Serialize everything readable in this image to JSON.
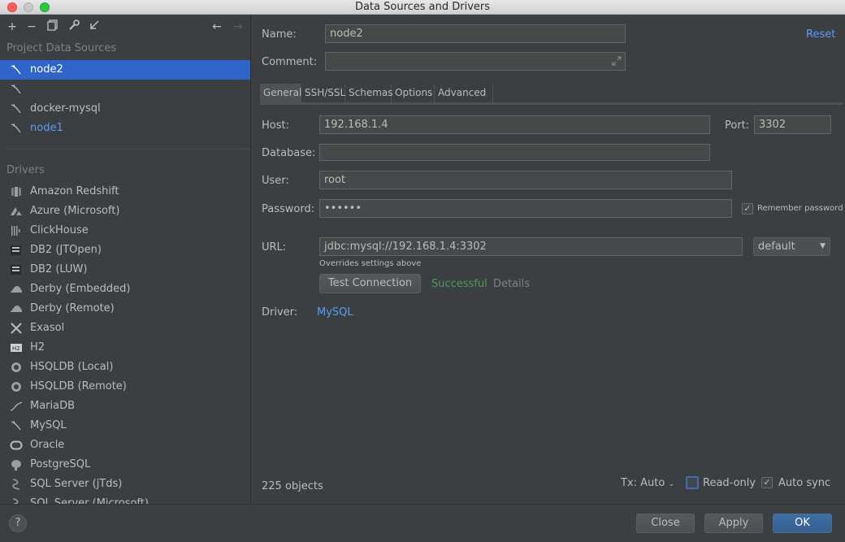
{
  "window": {
    "title": "Data Sources and Drivers"
  },
  "sidebar": {
    "project_heading": "Project Data Sources",
    "data_sources": [
      {
        "label": "node2",
        "state": "selected"
      },
      {
        "label": "",
        "state": "normal"
      },
      {
        "label": "docker-mysql",
        "state": "normal"
      },
      {
        "label": "node1",
        "state": "linked"
      }
    ],
    "drivers_heading": "Drivers",
    "drivers": [
      {
        "label": "Amazon Redshift",
        "icon": "redshift-icon"
      },
      {
        "label": "Azure (Microsoft)",
        "icon": "azure-icon"
      },
      {
        "label": "ClickHouse",
        "icon": "clickhouse-icon"
      },
      {
        "label": "DB2 (JTOpen)",
        "icon": "db2-icon"
      },
      {
        "label": "DB2 (LUW)",
        "icon": "db2-icon"
      },
      {
        "label": "Derby (Embedded)",
        "icon": "derby-icon"
      },
      {
        "label": "Derby (Remote)",
        "icon": "derby-icon"
      },
      {
        "label": "Exasol",
        "icon": "exasol-icon"
      },
      {
        "label": "H2",
        "icon": "h2-icon"
      },
      {
        "label": "HSQLDB (Local)",
        "icon": "hsqldb-icon"
      },
      {
        "label": "HSQLDB (Remote)",
        "icon": "hsqldb-icon"
      },
      {
        "label": "MariaDB",
        "icon": "mariadb-icon"
      },
      {
        "label": "MySQL",
        "icon": "mysql-icon"
      },
      {
        "label": "Oracle",
        "icon": "oracle-icon"
      },
      {
        "label": "PostgreSQL",
        "icon": "postgresql-icon"
      },
      {
        "label": "SQL Server (jTds)",
        "icon": "sqlserver-icon"
      },
      {
        "label": "SQL Server (Microsoft)",
        "icon": "sqlserver-icon"
      }
    ]
  },
  "form": {
    "name_label": "Name:",
    "name_value": "node2",
    "reset_label": "Reset",
    "comment_label": "Comment:",
    "comment_value": "",
    "tabs": [
      "General",
      "SSH/SSL",
      "Schemas",
      "Options",
      "Advanced"
    ],
    "host_label": "Host:",
    "host_value": "192.168.1.4",
    "port_label": "Port:",
    "port_value": "3302",
    "database_label": "Database:",
    "database_value": "",
    "user_label": "User:",
    "user_value": "root",
    "password_label": "Password:",
    "password_value": "••••••",
    "remember_label": "Remember password",
    "url_label": "URL:",
    "url_value": "jdbc:mysql://192.168.1.4:3302",
    "url_mode": "default",
    "overrides_note": "Overrides settings above",
    "test_connection_label": "Test Connection",
    "test_status": "Successful",
    "details_label": "Details",
    "driver_label": "Driver:",
    "driver_value": "MySQL"
  },
  "status": {
    "objects_count": "225 objects",
    "tx_label": "Tx: Auto",
    "readonly_label": "Read-only",
    "autosync_label": "Auto sync"
  },
  "footer": {
    "help_label": "?",
    "close_label": "Close",
    "apply_label": "Apply",
    "ok_label": "OK"
  },
  "colors": {
    "background": "#3c3f41",
    "selection": "#2f65ca",
    "link": "#589df6",
    "success": "#499c54",
    "primary_button": "#365f91"
  }
}
